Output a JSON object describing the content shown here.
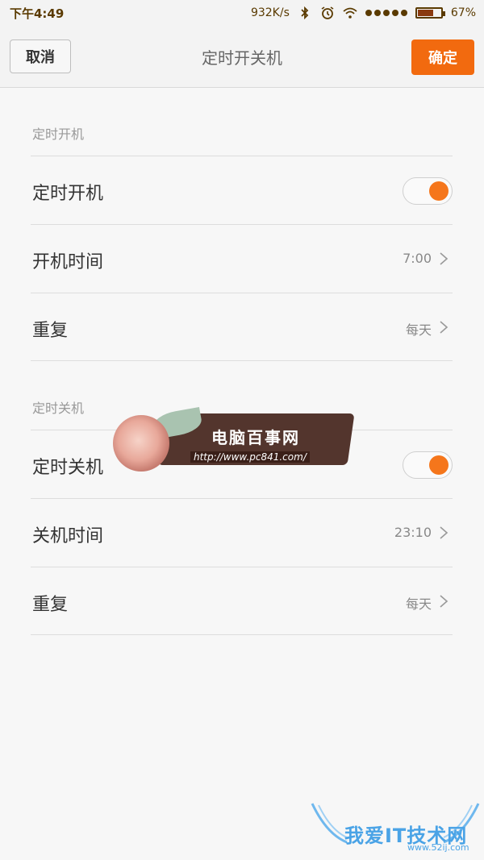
{
  "status": {
    "time": "下午4:49",
    "speed": "932K/s",
    "battery": "67%",
    "battery_level": 0.67,
    "icons": [
      "bluetooth-icon",
      "alarm-icon",
      "wifi-icon",
      "signal-icon",
      "battery-icon"
    ]
  },
  "navbar": {
    "cancel": "取消",
    "title": "定时开关机",
    "ok": "确定"
  },
  "sections": [
    {
      "header": "定时开机",
      "rows": [
        {
          "label": "定时开机",
          "type": "toggle",
          "on": true
        },
        {
          "label": "开机时间",
          "value": "7:00"
        },
        {
          "label": "重复",
          "value": "每天"
        }
      ]
    },
    {
      "header": "定时关机",
      "rows": [
        {
          "label": "定时关机",
          "type": "toggle",
          "on": true
        },
        {
          "label": "关机时间",
          "value": "23:10"
        },
        {
          "label": "重复",
          "value": "每天"
        }
      ]
    }
  ],
  "watermark": {
    "text": "电脑百事网",
    "url": "http://www.pc841.com/"
  },
  "footer": {
    "logo": "我爱IT技术网",
    "sub": "www.52ij.com"
  },
  "colors": {
    "accent": "#f26a0f",
    "toggle_on": "#f5761b",
    "status_text": "#5a3a00"
  }
}
